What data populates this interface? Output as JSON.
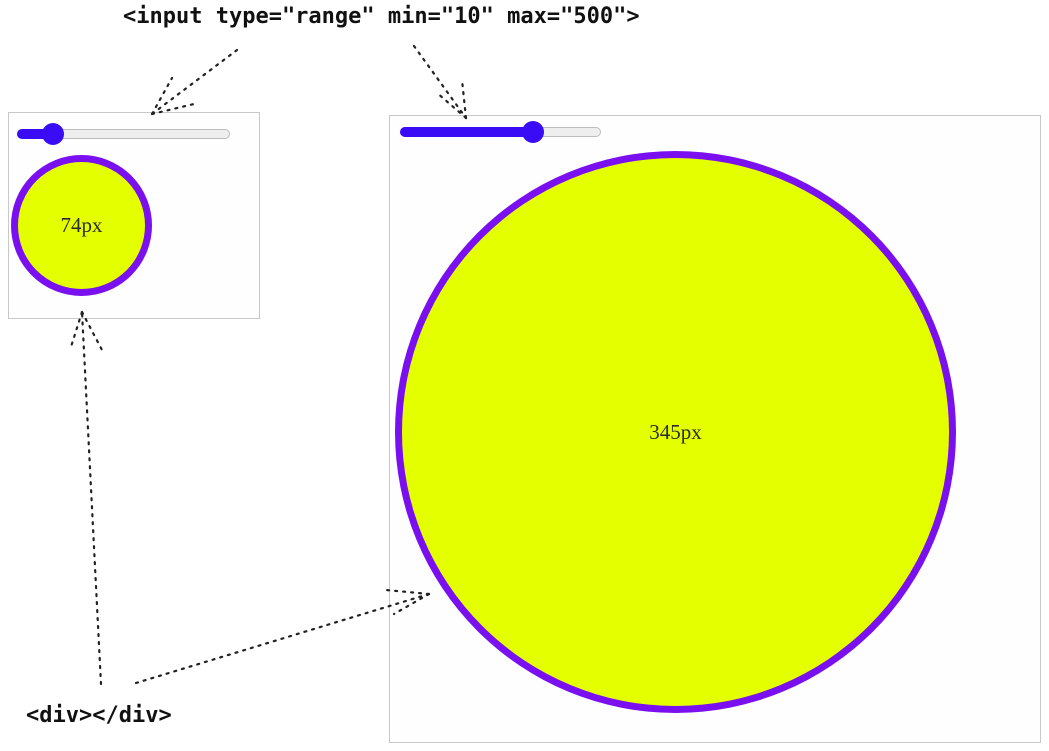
{
  "labels": {
    "input_code": "<input type=\"range\" min=\"10\" max=\"500\">",
    "div_code": "<div></div>"
  },
  "slider": {
    "min": 10,
    "max": 500
  },
  "demos": {
    "small": {
      "slider_value": 74,
      "circle_label": "74px"
    },
    "large": {
      "slider_value": 345,
      "circle_label": "345px"
    }
  },
  "colors": {
    "circle_fill": "#e3ff00",
    "circle_border": "#7a10f0",
    "slider_accent": "#3a0cf5",
    "slider_track": "#eeeeee",
    "arrow": "#222222"
  }
}
